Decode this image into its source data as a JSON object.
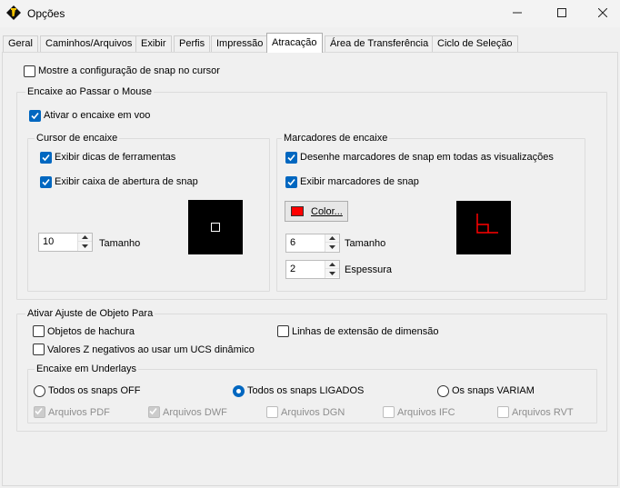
{
  "window": {
    "title": "Opções",
    "minimize": "—",
    "maximize": "☐",
    "close": "✕"
  },
  "tabs": [
    {
      "label": "Geral"
    },
    {
      "label": "Caminhos/Arquivos"
    },
    {
      "label": "Exibir"
    },
    {
      "label": "Perfis"
    },
    {
      "label": "Impressão"
    },
    {
      "label": "Atracação"
    },
    {
      "label": "Área de Transferência"
    },
    {
      "label": "Ciclo de Seleção"
    }
  ],
  "active_tab": "Atracação",
  "show_snap_config": {
    "label": "Mostre a configuração de snap no cursor",
    "checked": false
  },
  "hover_snap": {
    "title": "Encaixe ao Passar o Mouse",
    "enable": {
      "label": "Ativar o encaixe em voo",
      "checked": true
    },
    "cursor": {
      "title": "Cursor de encaixe",
      "tooltips": {
        "label": "Exibir dicas de ferramentas",
        "checked": true
      },
      "aperture": {
        "label": "Exibir caixa de abertura de snap",
        "checked": true
      },
      "size_value": "10",
      "size_label": "Tamanho"
    },
    "markers": {
      "title": "Marcadores de encaixe",
      "draw_all": {
        "label": "Desenhe marcadores de snap em todas as visualizações",
        "checked": true
      },
      "show": {
        "label": "Exibir marcadores de snap",
        "checked": true
      },
      "color_button": "Color...",
      "color": "#ff0000",
      "size_value": "6",
      "size_label": "Tamanho",
      "thickness_value": "2",
      "thickness_label": "Espessura"
    }
  },
  "object_snap": {
    "title": "Ativar Ajuste de Objeto Para",
    "hatch": {
      "label": "Objetos de hachura",
      "checked": false
    },
    "dimension_ext": {
      "label": "Linhas de extensão de dimensão",
      "checked": false
    },
    "negative_z": {
      "label": "Valores Z negativos ao usar um UCS dinâmico",
      "checked": false
    },
    "underlays": {
      "title": "Encaixe em Underlays",
      "options": [
        {
          "label": "Todos os snaps OFF",
          "selected": false
        },
        {
          "label": "Todos os snaps LIGADOS",
          "selected": true
        },
        {
          "label": "Os snaps VARIAM",
          "selected": false
        }
      ],
      "files": [
        {
          "label": "Arquivos PDF",
          "checked": true
        },
        {
          "label": "Arquivos DWF",
          "checked": true
        },
        {
          "label": "Arquivos DGN",
          "checked": false
        },
        {
          "label": "Arquivos IFC",
          "checked": false
        },
        {
          "label": "Arquivos RVT",
          "checked": false
        }
      ]
    }
  },
  "colors": {
    "accent": "#0067c0",
    "preview_bg": "#000000",
    "marker": "#ff0000"
  }
}
